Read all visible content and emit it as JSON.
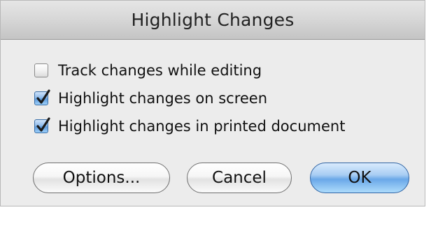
{
  "dialog": {
    "title": "Highlight Changes"
  },
  "options": [
    {
      "label": "Track changes while editing",
      "checked": false
    },
    {
      "label": "Highlight changes on screen",
      "checked": true
    },
    {
      "label": "Highlight changes in printed document",
      "checked": true
    }
  ],
  "buttons": {
    "options_label": "Options...",
    "cancel_label": "Cancel",
    "ok_label": "OK"
  },
  "colors": {
    "dialog_bg": "#ececec",
    "accent_blue": "#6aa8e8"
  },
  "icons": {
    "check": "checkmark-icon"
  }
}
